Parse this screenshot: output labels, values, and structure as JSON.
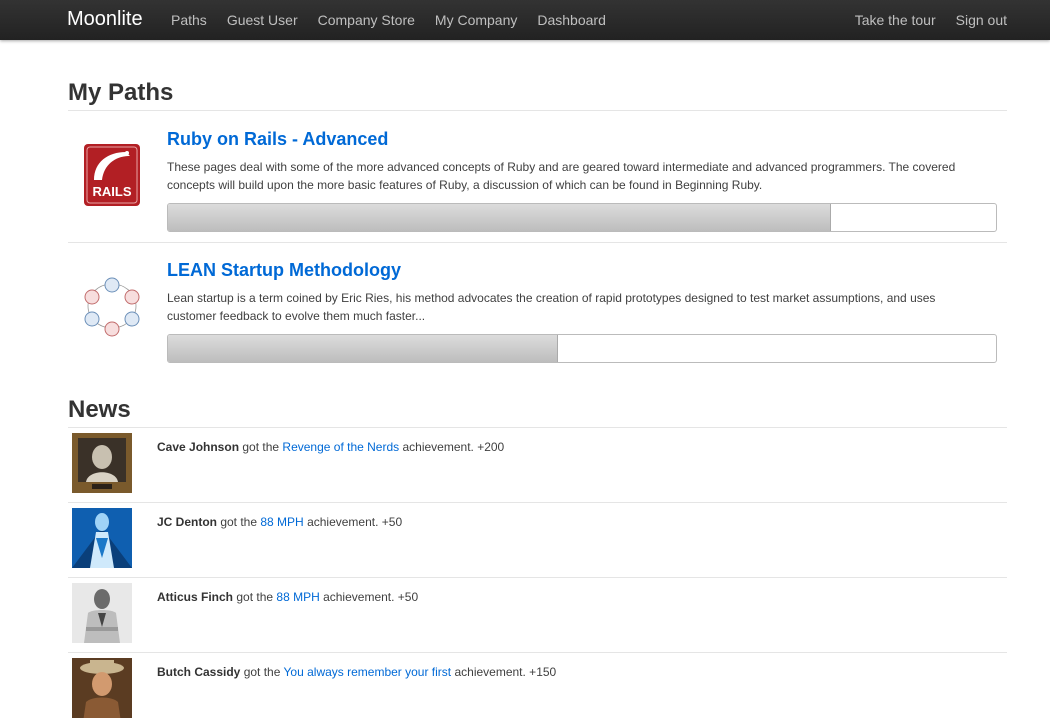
{
  "navbar": {
    "brand": "Moonlite",
    "left_links": [
      "Paths",
      "Guest User",
      "Company Store",
      "My Company",
      "Dashboard"
    ],
    "right_links": [
      "Take the tour",
      "Sign out"
    ]
  },
  "paths": {
    "title": "My Paths",
    "items": [
      {
        "title": "Ruby on Rails - Advanced",
        "description": "These pages deal with some of the more advanced concepts of Ruby and are geared toward intermediate and advanced programmers. The covered concepts will build upon the more basic features of Ruby, a discussion of which can be found in Beginning Ruby.",
        "progress": 0.8,
        "icon": "rails-logo",
        "logo_text": "RAILS"
      },
      {
        "title": "LEAN Startup Methodology",
        "description": "Lean startup is a term coined by Eric Ries, his method advocates the creation of rapid prototypes designed to test market assumptions, and uses customer feedback to evolve them much faster...",
        "progress": 0.47,
        "icon": "lean-cycle-diagram"
      }
    ]
  },
  "news": {
    "title": "News",
    "items": [
      {
        "user": "Cave Johnson",
        "got": " got the ",
        "achievement": "Revenge of the Nerds",
        "suffix": " achievement. +200",
        "avatar": "framed-portrait"
      },
      {
        "user": "JC Denton",
        "got": " got the ",
        "achievement": "88 MPH",
        "suffix": " achievement. +50",
        "avatar": "cyber-figure"
      },
      {
        "user": "Atticus Finch",
        "got": " got the ",
        "achievement": "88 MPH",
        "suffix": " achievement. +50",
        "avatar": "bw-portrait"
      },
      {
        "user": "Butch Cassidy",
        "got": " got the ",
        "achievement": "You always remember your first",
        "suffix": " achievement. +150",
        "avatar": "cowboy-portrait"
      }
    ]
  },
  "colors": {
    "link": "#0069d6",
    "navbar": "#222222",
    "rails_red": "#b21f24"
  }
}
